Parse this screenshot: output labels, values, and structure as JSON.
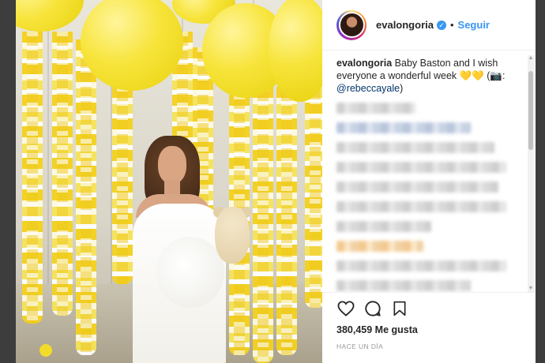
{
  "post": {
    "username": "evalongoria",
    "follow_label": "Seguir",
    "separator": "•",
    "caption_user": "evalongoria",
    "caption_text": "Baby Baston and I wish everyone a wonderful week 💛💛 (📷:",
    "caption_mention": "@rebeccayale",
    "caption_close": ")",
    "likes": "380,459 Me gusta",
    "timestamp": "HACE UN DÍA"
  },
  "icons": {
    "avatar": "profile-avatar",
    "verified": "verified-badge-icon",
    "like": "heart-icon",
    "comment": "comment-bubble-icon",
    "save": "bookmark-icon"
  },
  "colors": {
    "accent": "#3897f0",
    "text": "#262626",
    "muted": "#999999",
    "balloon": "#f7e43a"
  },
  "blurred_comment_rows": 10
}
